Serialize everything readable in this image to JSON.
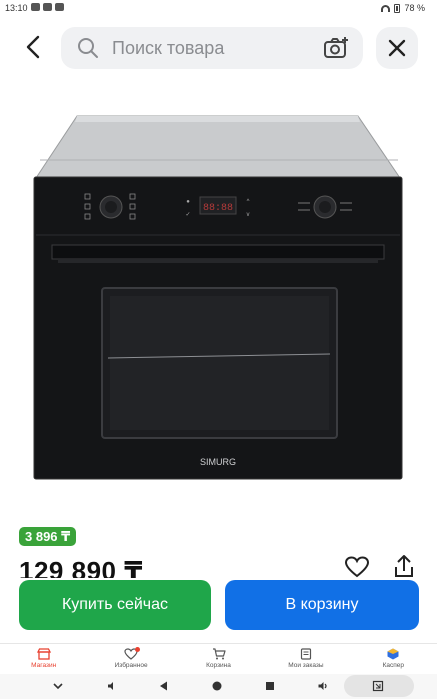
{
  "status_bar": {
    "time": "13:10",
    "battery": "78 %"
  },
  "search": {
    "placeholder": "Поиск товара"
  },
  "product": {
    "brand_on_image": "SIMURG",
    "display_value": "88:88",
    "cashback": "3 896 ₸",
    "price": "129 890 ₸"
  },
  "actions": {
    "buy_now": "Купить сейчас",
    "add_to_cart": "В корзину"
  },
  "bottom_nav": {
    "items": [
      {
        "label": "Магазин",
        "active": true
      },
      {
        "label": "Избранное",
        "active": false
      },
      {
        "label": "Корзина",
        "active": false
      },
      {
        "label": "Мои заказы",
        "active": false
      },
      {
        "label": "Каспер",
        "active": false
      }
    ]
  },
  "colors": {
    "buy_green": "#1fa64a",
    "cart_blue": "#1170e6",
    "cashback_green": "#3aa33a",
    "active_red": "#e8402f"
  }
}
